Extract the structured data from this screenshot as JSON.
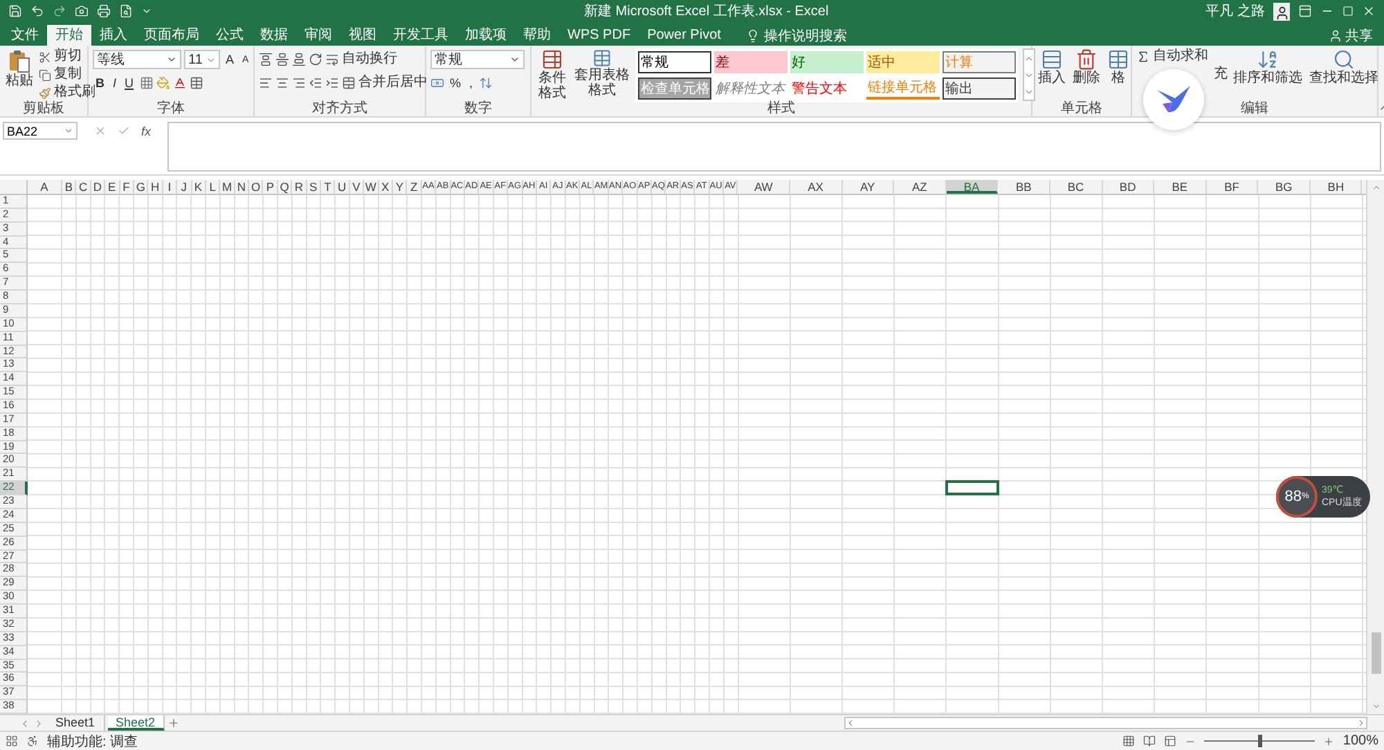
{
  "title_bar": {
    "title": "新建 Microsoft Excel 工作表.xlsx - Excel",
    "user": "平凡 之路"
  },
  "menu_tabs": [
    {
      "label": "文件",
      "selected": false
    },
    {
      "label": "开始",
      "selected": true
    },
    {
      "label": "插入",
      "selected": false
    },
    {
      "label": "页面布局",
      "selected": false
    },
    {
      "label": "公式",
      "selected": false
    },
    {
      "label": "数据",
      "selected": false
    },
    {
      "label": "审阅",
      "selected": false
    },
    {
      "label": "视图",
      "selected": false
    },
    {
      "label": "开发工具",
      "selected": false
    },
    {
      "label": "加载项",
      "selected": false
    },
    {
      "label": "帮助",
      "selected": false
    },
    {
      "label": "WPS PDF",
      "selected": false
    },
    {
      "label": "Power Pivot",
      "selected": false
    }
  ],
  "search": {
    "placeholder": "操作说明搜索"
  },
  "share": "共享",
  "ribbon": {
    "clipboard": {
      "label": "剪贴板",
      "paste": "粘贴",
      "cut": "剪切",
      "copy": "复制",
      "format_painter": "格式刷"
    },
    "font": {
      "label": "字体",
      "font_name": "等线",
      "font_size": "11",
      "bold": "B",
      "italic": "I",
      "underline": "U",
      "grow": "A",
      "shrink": "A"
    },
    "alignment": {
      "label": "对齐方式",
      "wrap_text": "自动换行",
      "merge": "合并后居中"
    },
    "number": {
      "label": "数字",
      "format": "常规",
      "percent": "%",
      "comma": ","
    },
    "styles": {
      "label": "样式",
      "conditional": "条件格式",
      "table": "套用表格格式",
      "cells": [
        {
          "text": "常规",
          "kind": "normal",
          "color": "#000000"
        },
        {
          "text": "差",
          "kind": "bad",
          "color": "#9c0006"
        },
        {
          "text": "好",
          "kind": "good",
          "color": "#006100"
        },
        {
          "text": "适中",
          "kind": "neutral",
          "color": "#9c5700"
        },
        {
          "text": "计算",
          "kind": "calc",
          "color": "#fa7d00"
        },
        {
          "text": "检查单元格",
          "kind": "check",
          "color": "#ffffff"
        },
        {
          "text": "解释性文本",
          "kind": "note",
          "color": "#7f7f7f"
        },
        {
          "text": "警告文本",
          "kind": "warning",
          "color": "#ff0000"
        },
        {
          "text": "链接单元格",
          "kind": "link",
          "color": "#fa7d00"
        },
        {
          "text": "输出",
          "kind": "output",
          "color": "#3f3f3f"
        }
      ]
    },
    "cells": {
      "label": "单元格",
      "insert": "插入",
      "delete": "删除",
      "format": "格"
    },
    "editing": {
      "label": "编辑",
      "autosum": "自动求和",
      "fill": "充",
      "sort": "排序和筛选",
      "find": "查找和选择"
    }
  },
  "formula_bar": {
    "name_box": "BA22",
    "fx": "fx"
  },
  "columns": [
    {
      "label": "A",
      "selected": false
    },
    {
      "label": "B",
      "selected": false
    },
    {
      "label": "C",
      "selected": false
    },
    {
      "label": "D",
      "selected": false
    },
    {
      "label": "E",
      "selected": false
    },
    {
      "label": "F",
      "selected": false
    },
    {
      "label": "G",
      "selected": false
    },
    {
      "label": "H",
      "selected": false
    },
    {
      "label": "I",
      "selected": false
    },
    {
      "label": "J",
      "selected": false
    },
    {
      "label": "K",
      "selected": false
    },
    {
      "label": "L",
      "selected": false
    },
    {
      "label": "M",
      "selected": false
    },
    {
      "label": "N",
      "selected": false
    },
    {
      "label": "O",
      "selected": false
    },
    {
      "label": "P",
      "selected": false
    },
    {
      "label": "Q",
      "selected": false
    },
    {
      "label": "R",
      "selected": false
    },
    {
      "label": "S",
      "selected": false
    },
    {
      "label": "T",
      "selected": false
    },
    {
      "label": "U",
      "selected": false
    },
    {
      "label": "V",
      "selected": false
    },
    {
      "label": "W",
      "selected": false
    },
    {
      "label": "X",
      "selected": false
    },
    {
      "label": "Y",
      "selected": false
    },
    {
      "label": "Z",
      "selected": false
    },
    {
      "label": "AA",
      "selected": false
    },
    {
      "label": "AB",
      "selected": false
    },
    {
      "label": "AC",
      "selected": false
    },
    {
      "label": "AD",
      "selected": false
    },
    {
      "label": "AE",
      "selected": false
    },
    {
      "label": "AF",
      "selected": false
    },
    {
      "label": "AG",
      "selected": false
    },
    {
      "label": "AH",
      "selected": false
    },
    {
      "label": "AI",
      "selected": false
    },
    {
      "label": "AJ",
      "selected": false
    },
    {
      "label": "AK",
      "selected": false
    },
    {
      "label": "AL",
      "selected": false
    },
    {
      "label": "AM",
      "selected": false
    },
    {
      "label": "AN",
      "selected": false
    },
    {
      "label": "AO",
      "selected": false
    },
    {
      "label": "AP",
      "selected": false
    },
    {
      "label": "AQ",
      "selected": false
    },
    {
      "label": "AR",
      "selected": false
    },
    {
      "label": "AS",
      "selected": false
    },
    {
      "label": "AT",
      "selected": false
    },
    {
      "label": "AU",
      "selected": false
    },
    {
      "label": "AV",
      "selected": false
    },
    {
      "label": "AW",
      "selected": false
    },
    {
      "label": "AX",
      "selected": false
    },
    {
      "label": "AY",
      "selected": false
    },
    {
      "label": "AZ",
      "selected": false
    },
    {
      "label": "BA",
      "selected": true
    },
    {
      "label": "BB",
      "selected": false
    },
    {
      "label": "BC",
      "selected": false
    },
    {
      "label": "BD",
      "selected": false
    },
    {
      "label": "BE",
      "selected": false
    },
    {
      "label": "BF",
      "selected": false
    },
    {
      "label": "BG",
      "selected": false
    },
    {
      "label": "BH",
      "selected": false
    }
  ],
  "rows": [
    {
      "label": "1",
      "selected": false
    },
    {
      "label": "2",
      "selected": false
    },
    {
      "label": "3",
      "selected": false
    },
    {
      "label": "4",
      "selected": false
    },
    {
      "label": "5",
      "selected": false
    },
    {
      "label": "6",
      "selected": false
    },
    {
      "label": "7",
      "selected": false
    },
    {
      "label": "8",
      "selected": false
    },
    {
      "label": "9",
      "selected": false
    },
    {
      "label": "10",
      "selected": false
    },
    {
      "label": "11",
      "selected": false
    },
    {
      "label": "12",
      "selected": false
    },
    {
      "label": "13",
      "selected": false
    },
    {
      "label": "14",
      "selected": false
    },
    {
      "label": "15",
      "selected": false
    },
    {
      "label": "16",
      "selected": false
    },
    {
      "label": "17",
      "selected": false
    },
    {
      "label": "18",
      "selected": false
    },
    {
      "label": "19",
      "selected": false
    },
    {
      "label": "20",
      "selected": false
    },
    {
      "label": "21",
      "selected": false
    },
    {
      "label": "22",
      "selected": true
    },
    {
      "label": "23",
      "selected": false
    },
    {
      "label": "24",
      "selected": false
    },
    {
      "label": "25",
      "selected": false
    },
    {
      "label": "26",
      "selected": false
    },
    {
      "label": "27",
      "selected": false
    },
    {
      "label": "28",
      "selected": false
    },
    {
      "label": "29",
      "selected": false
    },
    {
      "label": "30",
      "selected": false
    },
    {
      "label": "31",
      "selected": false
    },
    {
      "label": "32",
      "selected": false
    },
    {
      "label": "33",
      "selected": false
    },
    {
      "label": "34",
      "selected": false
    },
    {
      "label": "35",
      "selected": false
    },
    {
      "label": "36",
      "selected": false
    },
    {
      "label": "37",
      "selected": false
    },
    {
      "label": "38",
      "selected": false
    }
  ],
  "sheets": [
    {
      "label": "Sheet1",
      "selected": false
    },
    {
      "label": "Sheet2",
      "selected": true
    }
  ],
  "status_bar": {
    "accessibility": "辅助功能: 调查",
    "zoom_slider": {
      "level": 0.5
    },
    "zoom": "100%"
  },
  "cpu_widget": {
    "usage": "88",
    "unit": "%",
    "temperature": "39℃",
    "label": "CPU温度"
  }
}
